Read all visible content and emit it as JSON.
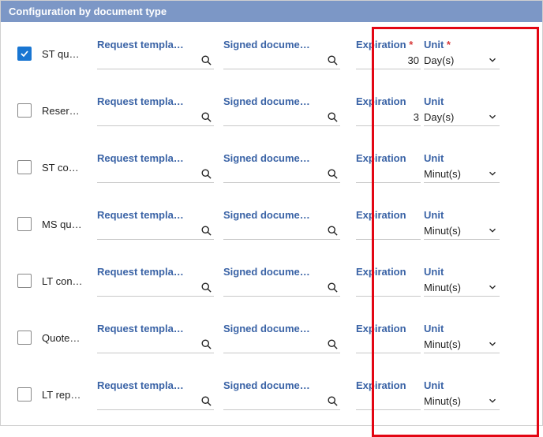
{
  "panel": {
    "title": "Configuration by document type"
  },
  "labels": {
    "request_template": "Request templa…",
    "signed_document": "Signed docume…",
    "expiration": "Expiration",
    "unit": "Unit"
  },
  "rows": [
    {
      "checked": true,
      "doc": "ST qu…",
      "required": true,
      "expiration": "30",
      "unit": "Day(s)"
    },
    {
      "checked": false,
      "doc": "Reser…",
      "required": false,
      "expiration": "3",
      "unit": "Day(s)"
    },
    {
      "checked": false,
      "doc": "ST co…",
      "required": false,
      "expiration": "",
      "unit": "Minut(s)"
    },
    {
      "checked": false,
      "doc": "MS qu…",
      "required": false,
      "expiration": "",
      "unit": "Minut(s)"
    },
    {
      "checked": false,
      "doc": "LT con…",
      "required": false,
      "expiration": "",
      "unit": "Minut(s)"
    },
    {
      "checked": false,
      "doc": "Quote…",
      "required": false,
      "expiration": "",
      "unit": "Minut(s)"
    },
    {
      "checked": false,
      "doc": "LT rep…",
      "required": false,
      "expiration": "",
      "unit": "Minut(s)"
    }
  ]
}
